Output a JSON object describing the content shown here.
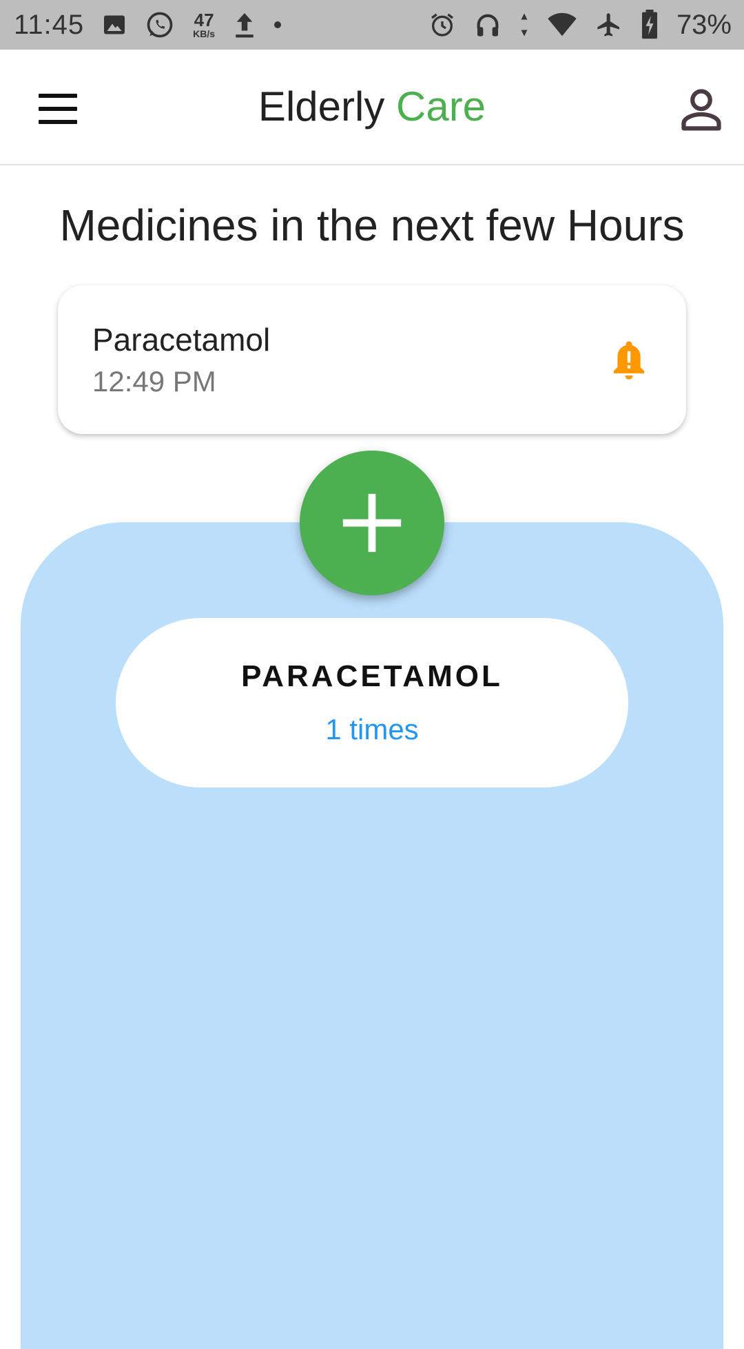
{
  "status_bar": {
    "time": "11:45",
    "net_speed_value": "47",
    "net_speed_unit": "KB/s",
    "battery_percent": "73%",
    "left_icons": [
      "image-icon",
      "whatsapp-icon",
      "upload-icon",
      "dot-icon"
    ],
    "right_icons": [
      "alarm-icon",
      "headphones-icon",
      "data-arrows-icon",
      "wifi-icon",
      "airplane-icon",
      "battery-charging-icon"
    ]
  },
  "app_bar": {
    "title_main": "Elderly",
    "title_accent": "Care",
    "menu_icon": "hamburger-menu-icon",
    "profile_icon": "person-icon"
  },
  "section": {
    "title": "Medicines in the next few Hours"
  },
  "upcoming": [
    {
      "name": "Paracetamol",
      "time": "12:49 PM",
      "icon": "bell-alert-icon"
    }
  ],
  "fab": {
    "icon": "plus-icon"
  },
  "medicines": [
    {
      "name": "PARACETAMOL",
      "frequency": "1 times"
    }
  ],
  "colors": {
    "accent_green": "#4caf50",
    "panel_blue": "#bbdefb",
    "link_blue": "#2196f3",
    "alert_orange": "#ff9800",
    "status_bar_gray": "#bdbdbd"
  }
}
